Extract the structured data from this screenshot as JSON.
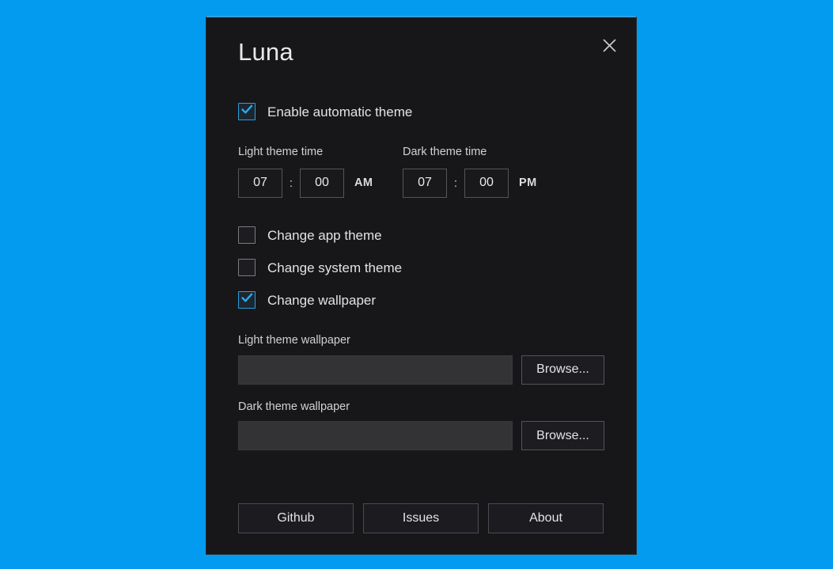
{
  "desktop": {
    "background_color": "#039BF0"
  },
  "window": {
    "title": "Luna",
    "accent_color": "#2f9fe0",
    "background_color": "#17171a",
    "close_icon": "close-icon"
  },
  "auto_theme": {
    "label": "Enable automatic theme",
    "checked": true
  },
  "time_settings": {
    "light": {
      "label": "Light theme time",
      "hour": "07",
      "separator": ":",
      "minute": "00",
      "meridiem": "AM"
    },
    "dark": {
      "label": "Dark theme time",
      "hour": "07",
      "separator": ":",
      "minute": "00",
      "meridiem": "PM"
    }
  },
  "options": [
    {
      "label": "Change app theme",
      "checked": false
    },
    {
      "label": "Change system theme",
      "checked": false
    },
    {
      "label": "Change wallpaper",
      "checked": true
    }
  ],
  "wallpapers": {
    "light": {
      "label": "Light theme wallpaper",
      "value": "",
      "placeholder": "",
      "browse_label": "Browse..."
    },
    "dark": {
      "label": "Dark theme wallpaper",
      "value": "",
      "placeholder": "",
      "browse_label": "Browse..."
    }
  },
  "footer": {
    "github_label": "Github",
    "issues_label": "Issues",
    "about_label": "About"
  }
}
